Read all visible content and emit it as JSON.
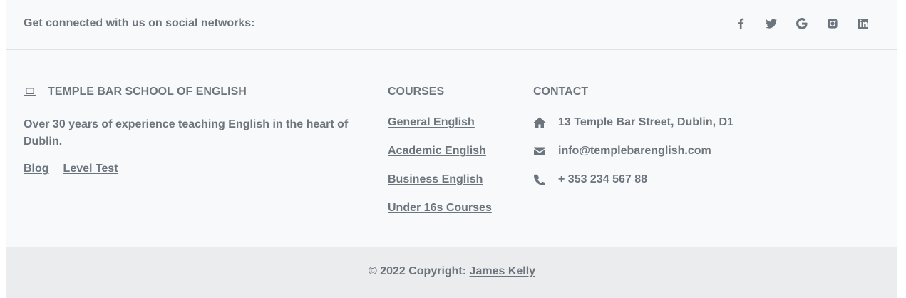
{
  "social": {
    "text": "Get connected with us on social networks:",
    "icons": [
      "facebook-icon",
      "twitter-icon",
      "google-icon",
      "instagram-icon",
      "linkedin-icon"
    ]
  },
  "about": {
    "icon": "laptop-icon",
    "title": "TEMPLE BAR SCHOOL OF ENGLISH",
    "description": "Over 30 years of experience teaching English in the heart of Dublin.",
    "links": [
      "Blog",
      "Level Test"
    ]
  },
  "courses": {
    "title": "COURSES",
    "items": [
      "General English",
      "Academic English",
      "Business English",
      "Under 16s Courses"
    ]
  },
  "contact": {
    "title": "CONTACT",
    "address": "13 Temple Bar Street, Dublin, D1",
    "email": "info@templebarenglish.com",
    "phone": "+ 353 234 567 88"
  },
  "copyright": {
    "text": "© 2022 Copyright:",
    "author": "James Kelly"
  },
  "colors": {
    "text": "#6c757d",
    "background": "#f8f9fa",
    "copyright_background": "#ebecee"
  }
}
